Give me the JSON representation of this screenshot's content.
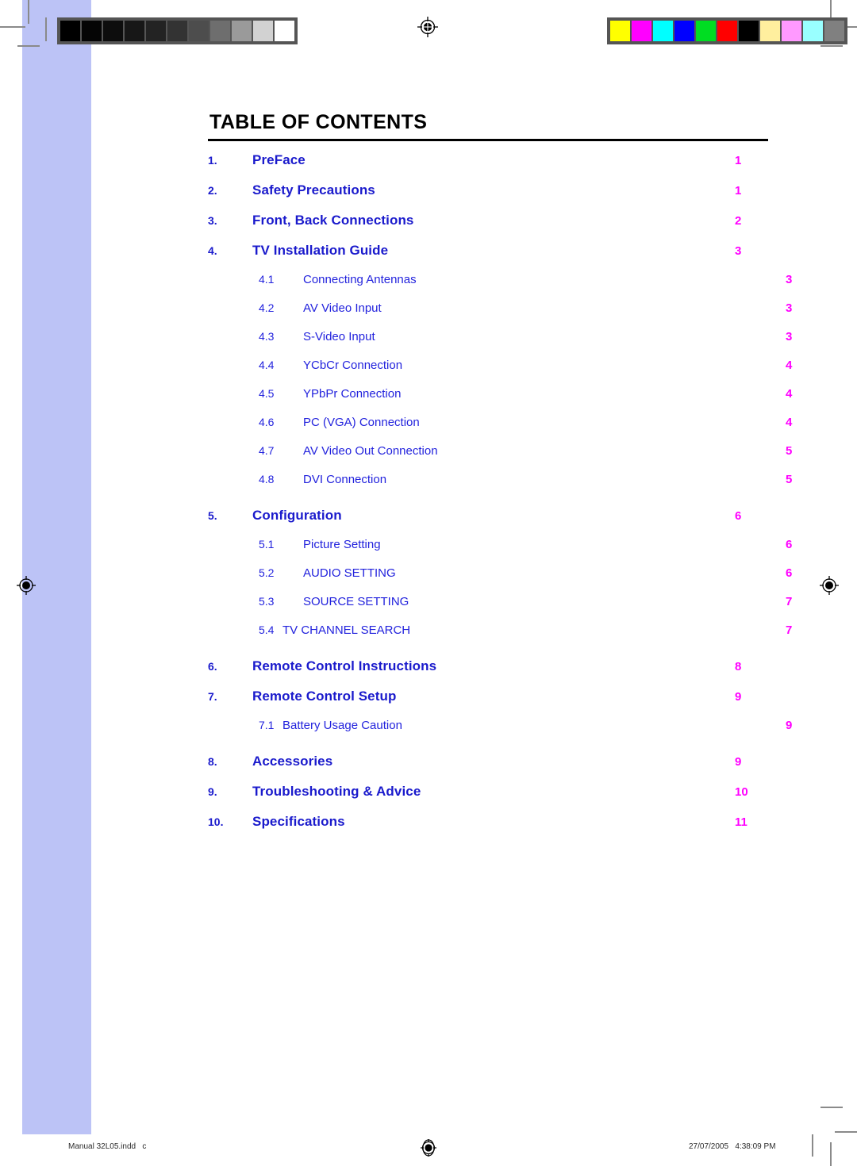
{
  "document": {
    "title": "TABLE OF CONTENTS"
  },
  "toc": {
    "entries": [
      {
        "level": 1,
        "number": "1.",
        "label": "PreFace",
        "page": "1"
      },
      {
        "level": 1,
        "number": "2.",
        "label": "Safety Precautions",
        "page": "1"
      },
      {
        "level": 1,
        "number": "3.",
        "label": "Front, Back Connections",
        "page": "2"
      },
      {
        "level": 1,
        "number": "4.",
        "label": "TV Installation Guide",
        "page": "3"
      },
      {
        "level": 2,
        "number": "4.1",
        "label": "Connecting Antennas",
        "page": "3"
      },
      {
        "level": 2,
        "number": "4.2",
        "label": "AV Video Input",
        "page": "3"
      },
      {
        "level": 2,
        "number": "4.3",
        "label": "S-Video Input",
        "page": "3"
      },
      {
        "level": 2,
        "number": "4.4",
        "label": "YCbCr Connection",
        "page": "4"
      },
      {
        "level": 2,
        "number": "4.5",
        "label": "YPbPr Connection",
        "page": "4"
      },
      {
        "level": 2,
        "number": "4.6",
        "label": "PC (VGA) Connection",
        "page": "4"
      },
      {
        "level": 2,
        "number": "4.7",
        "label": "AV Video Out Connection",
        "page": "5"
      },
      {
        "level": 2,
        "number": "4.8",
        "label": "DVI Connection",
        "page": "5"
      },
      {
        "level": 1,
        "number": "5.",
        "label": "Configuration",
        "page": "6"
      },
      {
        "level": 2,
        "number": "5.1",
        "label": "Picture Setting",
        "page": "6"
      },
      {
        "level": 2,
        "number": "5.2",
        "label": "AUDIO SETTING",
        "page": "6"
      },
      {
        "level": 2,
        "number": "5.3",
        "label": "SOURCE SETTING",
        "page": "7"
      },
      {
        "level": 2,
        "number": "5.4",
        "label": "TV CHANNEL SEARCH",
        "page": "7",
        "tight": true
      },
      {
        "level": 1,
        "number": "6.",
        "label": "Remote Control Instructions",
        "page": "8"
      },
      {
        "level": 1,
        "number": "7.",
        "label": "Remote Control Setup",
        "page": "9"
      },
      {
        "level": 2,
        "number": "7.1",
        "label": "Battery Usage Caution",
        "page": "9",
        "tight": true
      },
      {
        "level": 1,
        "number": "8.",
        "label": "Accessories",
        "page": "9"
      },
      {
        "level": 1,
        "number": "9.",
        "label": "Troubleshooting & Advice",
        "page": "10"
      },
      {
        "level": 1,
        "number": "10.",
        "label": "Specifications",
        "page": "11"
      }
    ]
  },
  "footer": {
    "file_label": "Manual 32L05.indd   c",
    "timestamp": "27/07/2005   4:38:09 PM"
  },
  "prepress": {
    "gray_strip": [
      "#000000",
      "#050505",
      "#0d0d0d",
      "#171717",
      "#232323",
      "#333333",
      "#4d4d4d",
      "#6e6e6e",
      "#9a9a9a",
      "#d2d2d2",
      "#ffffff"
    ],
    "color_strip": [
      "#ffff00",
      "#ff00ff",
      "#00ffff",
      "#0000ff",
      "#00dd22",
      "#ff0000",
      "#000000",
      "#ffef9e",
      "#ff99ff",
      "#99ffff",
      "#808080"
    ],
    "bleed_color": "#bcc3f6",
    "trim_mark_color": "#8a8a8a"
  },
  "colors": {
    "chapter_text": "#1a1acc",
    "section_text": "#2222dd",
    "page_number": "#ff00ff",
    "rule": "#000000"
  }
}
